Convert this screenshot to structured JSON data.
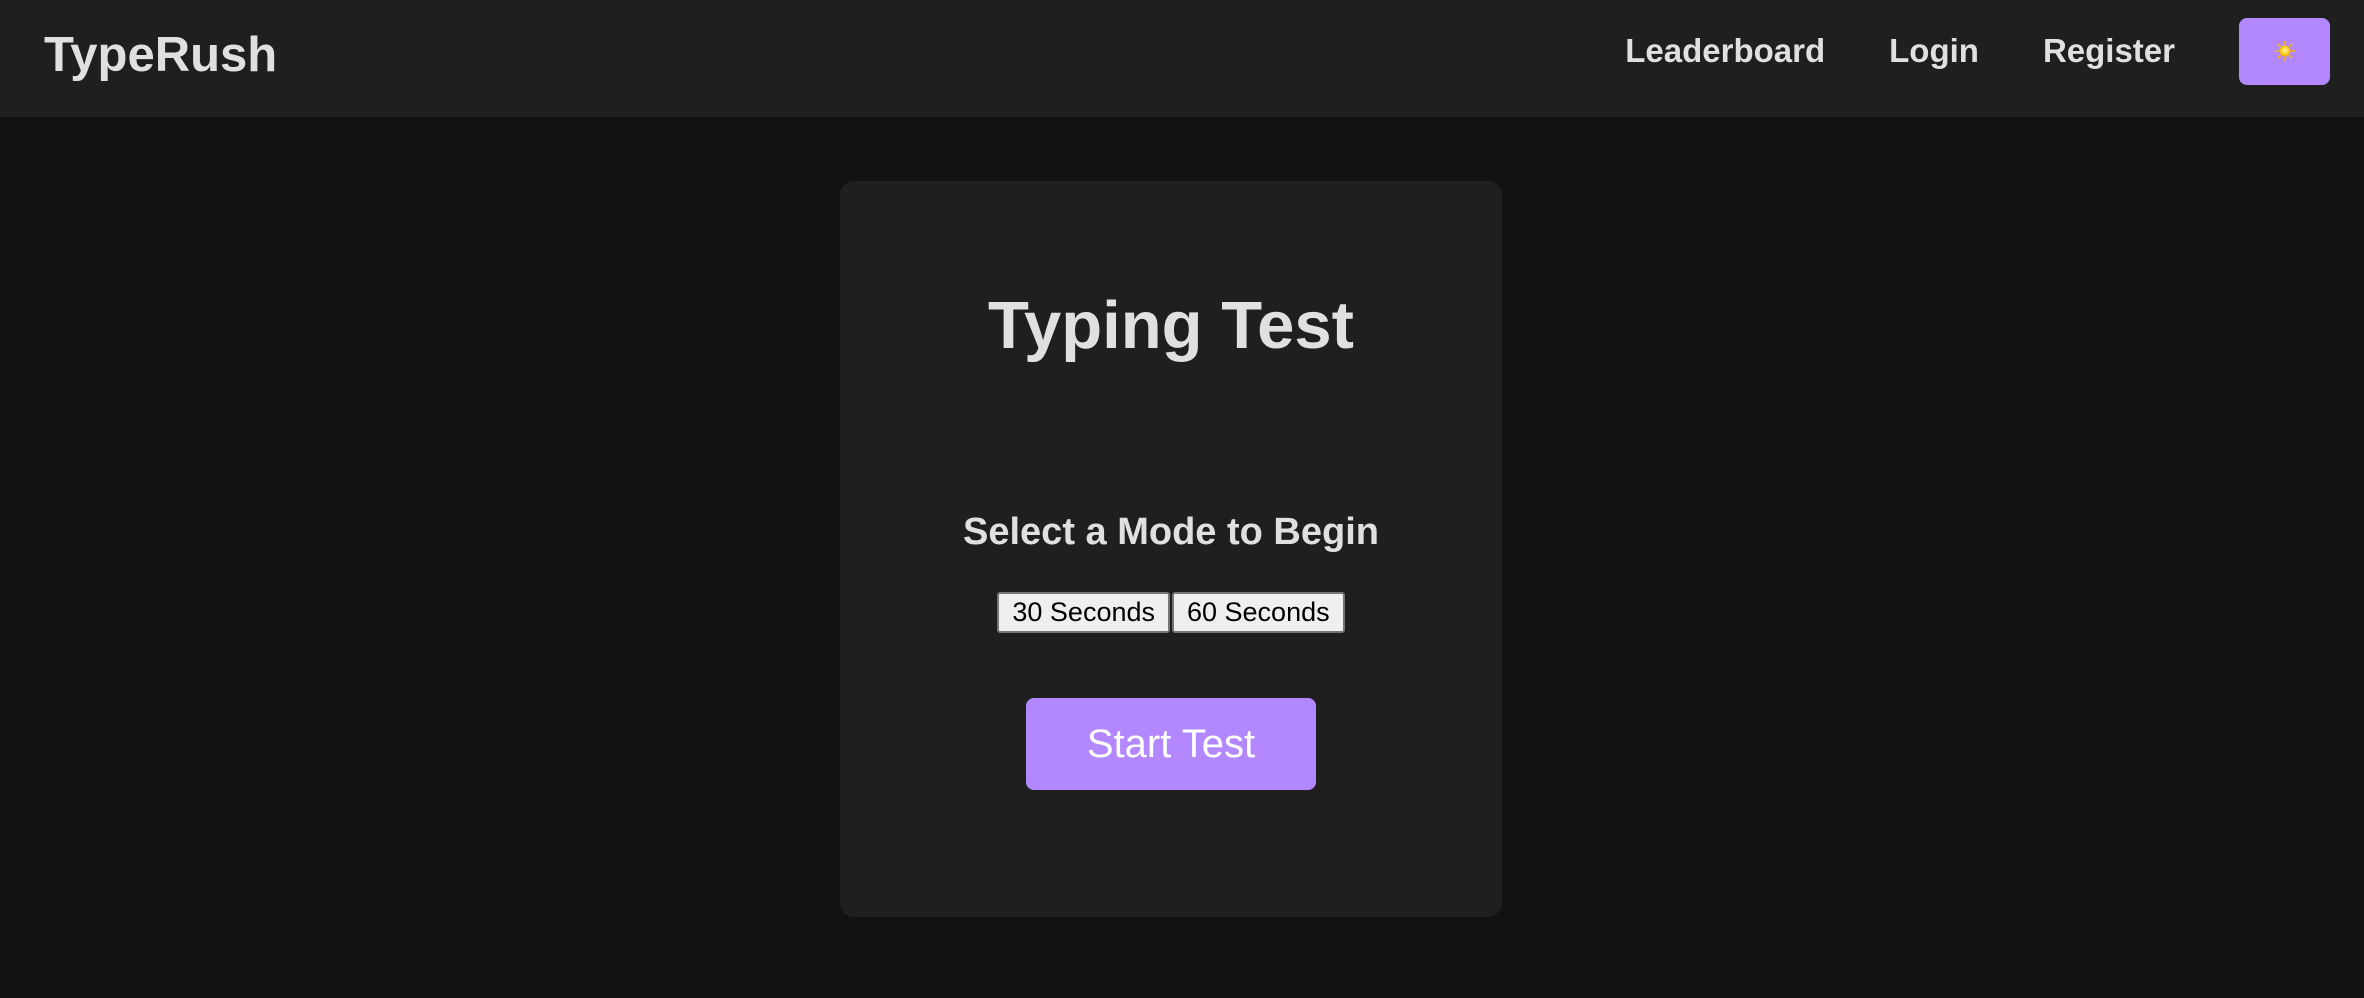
{
  "navbar": {
    "brand": "TypeRush",
    "links": [
      "Leaderboard",
      "Login",
      "Register"
    ],
    "theme_toggle_icon": "sun-icon"
  },
  "card": {
    "title": "Typing Test",
    "prompt": "Select a Mode to Begin",
    "modes": [
      "30 Seconds",
      "60 Seconds"
    ],
    "start_label": "Start Test"
  },
  "colors": {
    "page_background": "#121212",
    "surface": "#1f1f1f",
    "accent": "#b388ff",
    "text": "#e0e0e0"
  }
}
